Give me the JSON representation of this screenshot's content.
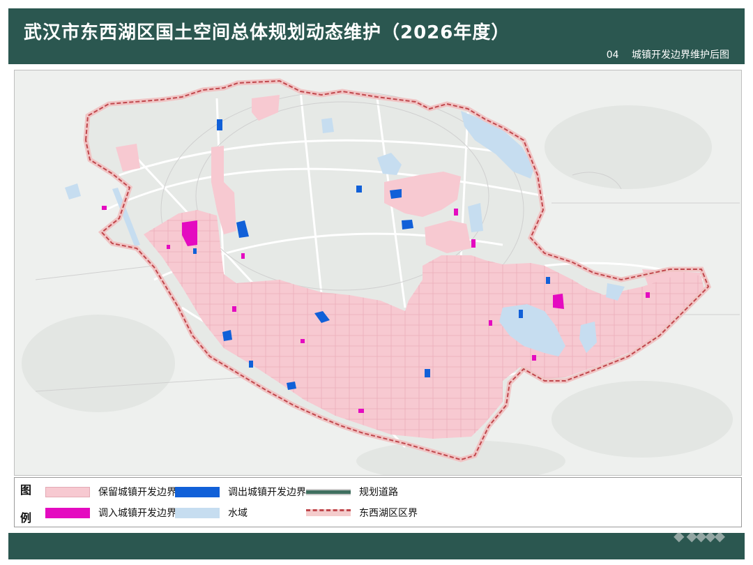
{
  "header": {
    "title": "武汉市东西湖区国土空间总体规划动态维护（2026年度）",
    "map_number": "04",
    "map_name": "城镇开发边界维护后图"
  },
  "legend": {
    "heading_top": "图",
    "heading_bottom": "例",
    "items": [
      {
        "label": "保留城镇开发边界",
        "color": "#f7c9d1",
        "symbol": "fill"
      },
      {
        "label": "调出城镇开发边界",
        "color": "#1160d8",
        "symbol": "fill"
      },
      {
        "label": "规划道路",
        "color": "#3f6f5f",
        "symbol": "road"
      },
      {
        "label": "调入城镇开发边界",
        "color": "#e40bc0",
        "symbol": "fill"
      },
      {
        "label": "水域",
        "color": "#c6ddf0",
        "symbol": "fill"
      },
      {
        "label": "东西湖区区界",
        "color": "#c0474c",
        "symbol": "boundary"
      }
    ]
  },
  "colors": {
    "header_bg": "#2b5750",
    "basemap": "#eef0ee",
    "retained": "#f7c9d1",
    "removed": "#1160d8",
    "added": "#e40bc0",
    "water": "#c6ddf0",
    "boundary": "#c0474c",
    "road": "#dadada"
  }
}
